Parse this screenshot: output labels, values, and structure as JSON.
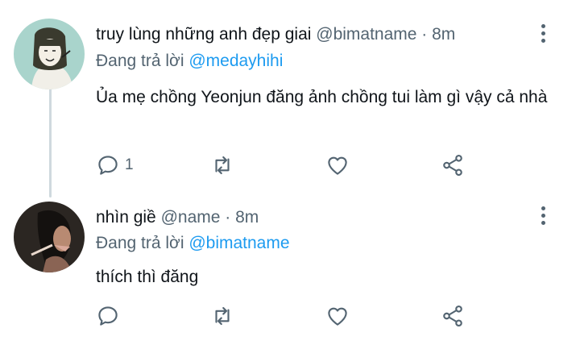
{
  "tweets": [
    {
      "name": "truy lùng những anh đẹp giai",
      "meta": "@bimatname · 8m",
      "reply_prefix": "Đang trả lời ",
      "reply_to": "@medayhihi",
      "text": "Ủa mẹ chồng Yeonjun đăng ảnh chồng tui làm gì vậy cả nhà",
      "reply_count": "1",
      "retweet_count": "",
      "like_count": ""
    },
    {
      "name": "nhìn giề",
      "meta": "@name · 8m",
      "reply_prefix": "Đang trả lời ",
      "reply_to": "@bimatname",
      "text": "thích thì đăng",
      "reply_count": "",
      "retweet_count": "",
      "like_count": ""
    }
  ],
  "icons": {
    "reply": "reply-icon",
    "retweet": "retweet-icon",
    "like": "heart-icon",
    "share": "share-icon",
    "more": "more-vertical-icon"
  },
  "colors": {
    "text": "#0f1419",
    "secondary": "#536471",
    "link": "#1d9bf0",
    "thread": "#cfd9de"
  }
}
